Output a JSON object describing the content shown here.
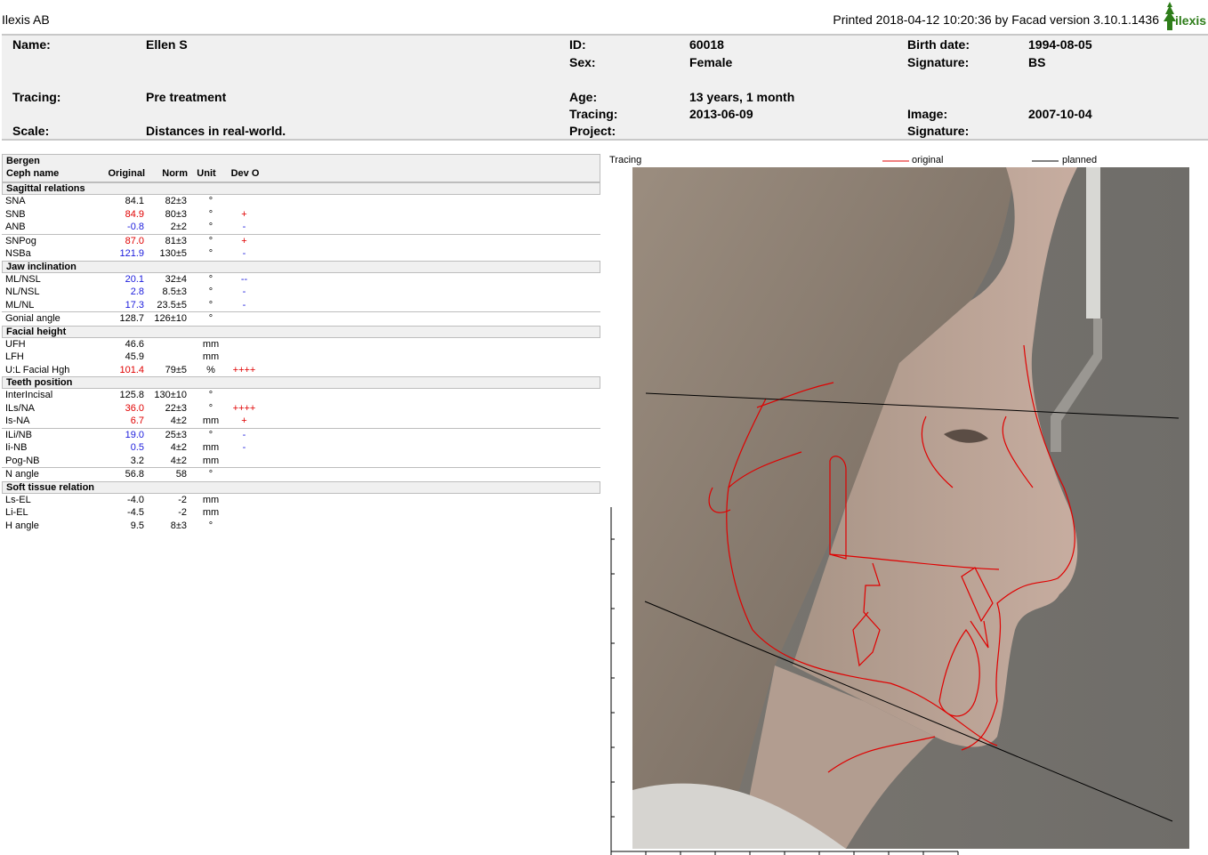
{
  "top": {
    "company": "Ilexis AB",
    "printed": "Printed 2018-04-12 10:20:36 by Facad version 3.10.1.1436",
    "logo_text": "ilexis",
    "logo_color": "#2e7d1a"
  },
  "header": {
    "name_label": "Name:",
    "name_value": "Ellen S",
    "id_label": "ID:",
    "id_value": "60018",
    "birth_label": "Birth date:",
    "birth_value": "1994-08-05",
    "sex_label": "Sex:",
    "sex_value": "Female",
    "signature1_label": "Signature:",
    "signature1_value": "BS",
    "tracing_label": "Tracing:",
    "tracing_value": "Pre treatment",
    "age_label": "Age:",
    "age_value": "13 years, 1 month",
    "tracing2_label": "Tracing:",
    "tracing2_value": "2013-06-09",
    "image_label": "Image:",
    "image_value": "2007-10-04",
    "scale_label": "Scale:",
    "scale_value": "Distances in real-world.",
    "project_label": "Project:",
    "project_value": "",
    "signature2_label": "Signature:",
    "signature2_value": ""
  },
  "table": {
    "title": "Bergen",
    "columns": {
      "name": "Ceph name",
      "orig": "Original",
      "norm": "Norm",
      "unit": "Unit",
      "dev": "Dev O"
    },
    "sections": [
      {
        "title": "Sagittal relations",
        "rows": [
          {
            "name": "SNA",
            "orig": "84.1",
            "norm": "82±3",
            "unit": "°",
            "dev": "",
            "color": "black",
            "sep": false
          },
          {
            "name": "SNB",
            "orig": "84.9",
            "norm": "80±3",
            "unit": "°",
            "dev": "+",
            "color": "red",
            "sep": false
          },
          {
            "name": "ANB",
            "orig": "-0.8",
            "norm": "2±2",
            "unit": "°",
            "dev": "-",
            "color": "blue",
            "sep": true
          },
          {
            "name": "SNPog",
            "orig": "87.0",
            "norm": "81±3",
            "unit": "°",
            "dev": "+",
            "color": "red",
            "sep": false
          },
          {
            "name": "NSBa",
            "orig": "121.9",
            "norm": "130±5",
            "unit": "°",
            "dev": "-",
            "color": "blue",
            "sep": false
          }
        ]
      },
      {
        "title": "Jaw inclination",
        "rows": [
          {
            "name": "ML/NSL",
            "orig": "20.1",
            "norm": "32±4",
            "unit": "°",
            "dev": "--",
            "color": "blue",
            "sep": false
          },
          {
            "name": "NL/NSL",
            "orig": "2.8",
            "norm": "8.5±3",
            "unit": "°",
            "dev": "-",
            "color": "blue",
            "sep": false
          },
          {
            "name": "ML/NL",
            "orig": "17.3",
            "norm": "23.5±5",
            "unit": "°",
            "dev": "-",
            "color": "blue",
            "sep": true
          },
          {
            "name": "Gonial angle",
            "orig": "128.7",
            "norm": "126±10",
            "unit": "°",
            "dev": "",
            "color": "black",
            "sep": false
          }
        ]
      },
      {
        "title": "Facial height",
        "rows": [
          {
            "name": "UFH",
            "orig": "46.6",
            "norm": "",
            "unit": "mm",
            "dev": "",
            "color": "black",
            "sep": false
          },
          {
            "name": "LFH",
            "orig": "45.9",
            "norm": "",
            "unit": "mm",
            "dev": "",
            "color": "black",
            "sep": false
          },
          {
            "name": "U:L Facial Hgh",
            "orig": "101.4",
            "norm": "79±5",
            "unit": "%",
            "dev": "++++",
            "color": "red",
            "sep": false
          }
        ]
      },
      {
        "title": "Teeth position",
        "rows": [
          {
            "name": "InterIncisal",
            "orig": "125.8",
            "norm": "130±10",
            "unit": "°",
            "dev": "",
            "color": "black",
            "sep": false
          },
          {
            "name": "ILs/NA",
            "orig": "36.0",
            "norm": "22±3",
            "unit": "°",
            "dev": "++++",
            "color": "red",
            "sep": false
          },
          {
            "name": "Is-NA",
            "orig": "6.7",
            "norm": "4±2",
            "unit": "mm",
            "dev": "+",
            "color": "red",
            "sep": true
          },
          {
            "name": "ILi/NB",
            "orig": "19.0",
            "norm": "25±3",
            "unit": "°",
            "dev": "-",
            "color": "blue",
            "sep": false
          },
          {
            "name": "Ii-NB",
            "orig": "0.5",
            "norm": "4±2",
            "unit": "mm",
            "dev": "-",
            "color": "blue",
            "sep": false
          },
          {
            "name": "Pog-NB",
            "orig": "3.2",
            "norm": "4±2",
            "unit": "mm",
            "dev": "",
            "color": "black",
            "sep": true
          },
          {
            "name": "N angle",
            "orig": "56.8",
            "norm": "58",
            "unit": "°",
            "dev": "",
            "color": "black",
            "sep": false
          }
        ]
      },
      {
        "title": "Soft tissue relation",
        "rows": [
          {
            "name": "Ls-EL",
            "orig": "-4.0",
            "norm": "-2",
            "unit": "mm",
            "dev": "",
            "color": "black",
            "sep": false
          },
          {
            "name": "Li-EL",
            "orig": "-4.5",
            "norm": "-2",
            "unit": "mm",
            "dev": "",
            "color": "black",
            "sep": false
          },
          {
            "name": "H angle",
            "orig": "9.5",
            "norm": "8±3",
            "unit": "°",
            "dev": "",
            "color": "black",
            "sep": false
          }
        ]
      }
    ]
  },
  "tracing": {
    "label": "Tracing",
    "legend_original": "original",
    "legend_planned": "planned",
    "original_color": "#e00000",
    "planned_color": "#000000"
  }
}
